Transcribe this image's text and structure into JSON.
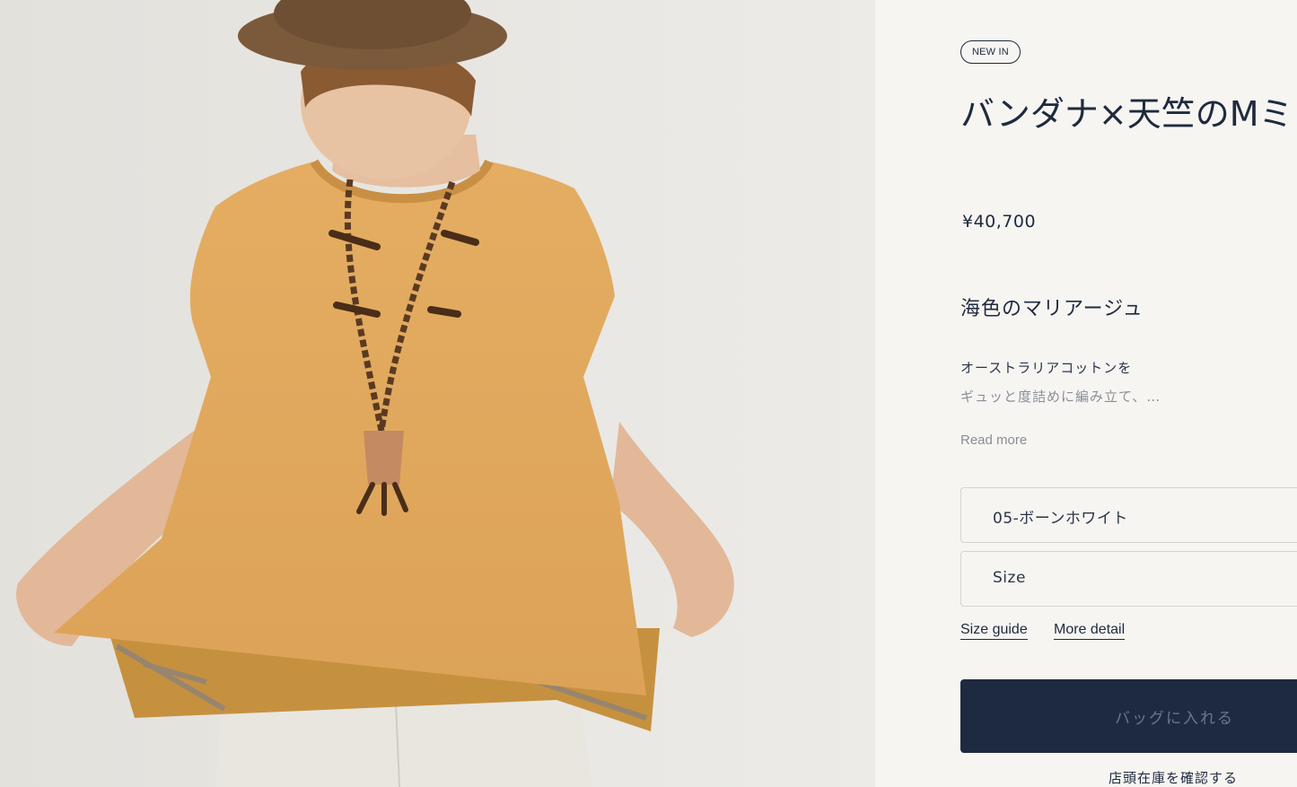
{
  "product": {
    "badge": "NEW IN",
    "title": "バンダナ×天竺のMミ",
    "price": "¥40,700",
    "subtitle": "海色のマリアージュ",
    "description_line1": "オーストラリアコットンを",
    "description_line2": "ギュッと度詰めに編み立て、…",
    "read_more": "Read more"
  },
  "options": {
    "color_value": "05-ボーンホワイト",
    "size_placeholder": "Size"
  },
  "links": {
    "size_guide": "Size guide",
    "more_detail": "More detail"
  },
  "actions": {
    "add_to_bag": "バッグに入れる",
    "check_store_stock": "店頭在庫を確認する"
  },
  "colors": {
    "navy": "#1e2a40",
    "background": "#f6f5f2",
    "shirt": "#e0a95c"
  }
}
